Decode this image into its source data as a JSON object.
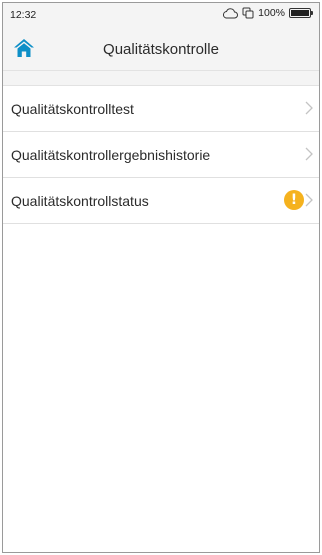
{
  "status_bar": {
    "time": "12:32",
    "battery_percent": "100%",
    "battery_level": 1.0,
    "icons": [
      "cloud-icon",
      "copy-icon",
      "battery-icon"
    ]
  },
  "header": {
    "title": "Qualitätskontrolle",
    "home_icon": "home-icon",
    "accent_color": "#0e8fc7"
  },
  "menu": {
    "items": [
      {
        "label": "Qualitätskontrolltest",
        "icon": "chevron-right-icon"
      },
      {
        "label": "Qualitätskontrollergebnishistorie",
        "icon": "chevron-right-icon"
      },
      {
        "label": "Qualitätskontrollstatus",
        "icon": "chevron-right-icon",
        "alert": "!",
        "alert_color": "#f5b21e"
      }
    ]
  }
}
